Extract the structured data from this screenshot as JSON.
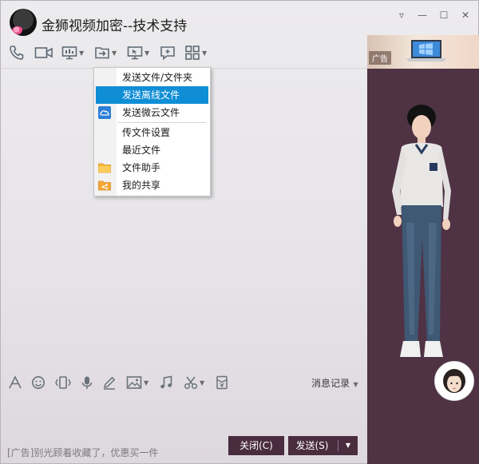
{
  "window": {
    "title": "金狮视频加密--技术支持",
    "controls": [
      "▿",
      "—",
      "☐",
      "✕"
    ]
  },
  "toolbar": {
    "icons": [
      "phone-icon",
      "video-call-icon",
      "screen-share-icon",
      "send-file-icon",
      "remote-desktop-icon",
      "comment-icon",
      "apps-icon"
    ]
  },
  "file_menu": {
    "items": [
      {
        "label": "发送文件/文件夹",
        "icon": null
      },
      {
        "label": "发送离线文件",
        "icon": null,
        "active": true
      },
      {
        "label": "发送微云文件",
        "icon": "weiyun-cloud-icon"
      },
      {
        "label": "传文件设置",
        "icon": null
      },
      {
        "label": "最近文件",
        "icon": null
      },
      {
        "label": "文件助手",
        "icon": "folder-icon"
      },
      {
        "label": "我的共享",
        "icon": "shared-folder-icon"
      }
    ]
  },
  "input_toolbar": {
    "history_label": "消息记录"
  },
  "footer": {
    "ad_text": "[广告]别光顾着收藏了，优惠买一件",
    "close_label": "关闭(C)",
    "send_label": "发送(S)"
  },
  "side_panel": {
    "ad_tag": "广告"
  },
  "colors": {
    "accent": "#0f8ed6",
    "button_bg": "#4a2c3f",
    "side_bg": "#4f3244"
  }
}
